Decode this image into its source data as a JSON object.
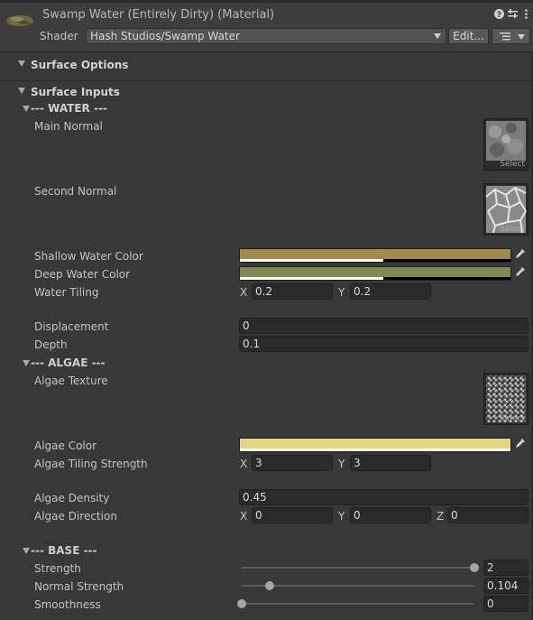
{
  "header": {
    "title": "Swamp Water (Entirely Dirty) (Material)",
    "shader_label": "Shader",
    "shader_value": "Hash Studios/Swamp Water",
    "edit_label": "Edit...",
    "icons": [
      "help-icon",
      "settings-sliders-icon",
      "menu-icon",
      "list-dropdown-icon"
    ]
  },
  "sections": {
    "surface_options": "Surface Options",
    "surface_inputs": "Surface Inputs"
  },
  "water": {
    "header": "--- WATER ---",
    "main_normal": "Main Normal",
    "second_normal": "Second Normal",
    "shallow_color_label": "Shallow Water Color",
    "shallow_color": "#a08c48",
    "shallow_alpha": 0.53,
    "deep_color_label": "Deep Water Color",
    "deep_color": "#7e8a4e",
    "deep_alpha": 0.53,
    "tiling_label": "Water Tiling",
    "tiling_x": "0.2",
    "tiling_y": "0.2",
    "displacement_label": "Displacement",
    "displacement": "0",
    "depth_label": "Depth",
    "depth": "0.1"
  },
  "algae": {
    "header": "--- ALGAE ---",
    "texture_label": "Algae Texture",
    "color_label": "Algae Color",
    "color": "#e4d57c",
    "alpha": 1.0,
    "tiling_label": "Algae Tiling Strength",
    "tiling_x": "3",
    "tiling_y": "3",
    "density_label": "Algae Density",
    "density": "0.45",
    "direction_label": "Algae Direction",
    "dir_x": "0",
    "dir_y": "0",
    "dir_z": "0"
  },
  "base": {
    "header": "--- BASE ---",
    "strength_label": "Strength",
    "strength": "2",
    "strength_pos": 1.0,
    "normal_strength_label": "Normal Strength",
    "normal_strength": "0.104",
    "normal_strength_pos": 0.12,
    "smoothness_label": "Smoothness",
    "smoothness": "0",
    "smoothness_pos": 0.0
  },
  "common": {
    "select": "Select",
    "x": "X",
    "y": "Y",
    "z": "Z"
  }
}
